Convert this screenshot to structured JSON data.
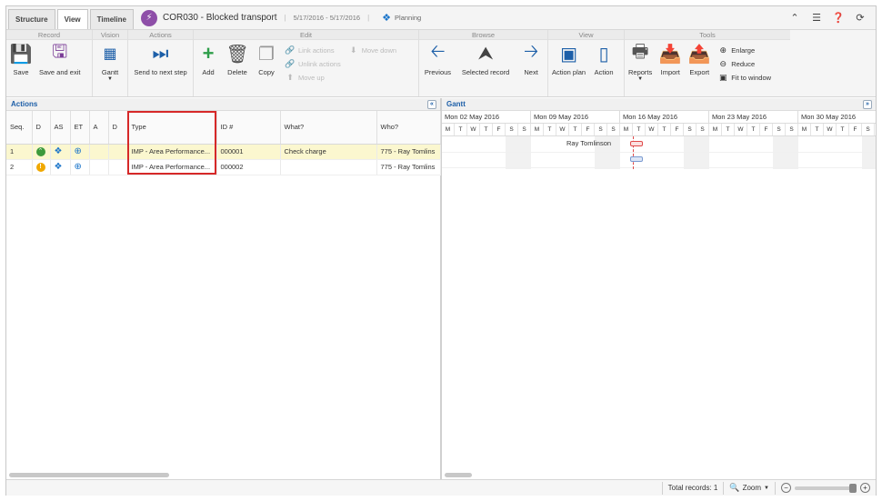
{
  "tabs": [
    {
      "label": "Structure"
    },
    {
      "label": "View"
    },
    {
      "label": "Timeline"
    }
  ],
  "header": {
    "title": "COR030 - Blocked transport",
    "dates": "5/17/2016 - 5/17/2016",
    "planning_label": "Planning"
  },
  "toolbar": {
    "record": {
      "title": "Record",
      "save": "Save",
      "save_exit": "Save and exit"
    },
    "vision": {
      "title": "Vision",
      "gantt": "Gantt"
    },
    "actions": {
      "title": "Actions",
      "send_next": "Send to next step"
    },
    "edit": {
      "title": "Edit",
      "add": "Add",
      "delete": "Delete",
      "copy": "Copy",
      "link": "Link actions",
      "unlink": "Unlink actions",
      "move_up": "Move up",
      "move_down": "Move down"
    },
    "browse": {
      "title": "Browse",
      "previous": "Previous",
      "selected": "Selected record",
      "next": "Next"
    },
    "view": {
      "title": "View",
      "action_plan": "Action plan",
      "action": "Action"
    },
    "tools": {
      "title": "Tools",
      "reports": "Reports",
      "import": "Import",
      "export": "Export",
      "enlarge": "Enlarge",
      "reduce": "Reduce",
      "fit": "Fit to window"
    }
  },
  "actions_panel": {
    "title": "Actions",
    "columns": [
      "Seq.",
      "D",
      "AS",
      "ET",
      "A",
      "D",
      "Type",
      "ID #",
      "What?",
      "Who?"
    ],
    "rows": [
      {
        "seq": "1",
        "type": "IMP - Area Performance...",
        "id": "000001",
        "what": "Check charge",
        "who": "775 - Ray Tomlins"
      },
      {
        "seq": "2",
        "type": "IMP - Area Performance...",
        "id": "000002",
        "what": "",
        "who": "775 - Ray Tomlins"
      }
    ]
  },
  "gantt_panel": {
    "title": "Gantt",
    "weeks": [
      "Mon 02 May 2016",
      "Mon 09 May 2016",
      "Mon 16 May 2016",
      "Mon 23 May 2016",
      "Mon 30 May 2016"
    ],
    "day_letters": [
      "M",
      "T",
      "W",
      "T",
      "F",
      "S",
      "S"
    ],
    "resource_label": "Ray Tomlinson",
    "colors": {
      "bar1": "#e04a4a",
      "bar2": "#7a9ad0"
    }
  },
  "status": {
    "total_records": "Total records: 1",
    "zoom_label": "Zoom"
  }
}
